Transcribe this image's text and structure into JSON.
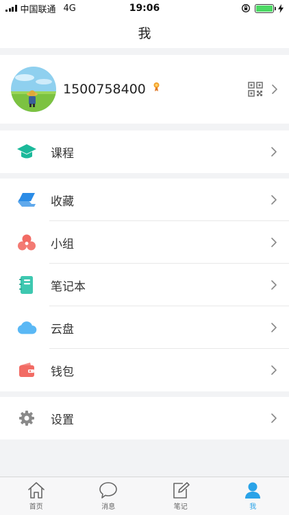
{
  "status_bar": {
    "carrier": "中国联通",
    "network": "4G",
    "time": "19:06"
  },
  "navbar": {
    "title": "我"
  },
  "profile": {
    "username": "1500758400"
  },
  "menu": {
    "course": {
      "label": "课程"
    },
    "favorites": {
      "label": "收藏"
    },
    "group": {
      "label": "小组"
    },
    "notebook": {
      "label": "笔记本"
    },
    "cloud": {
      "label": "云盘"
    },
    "wallet": {
      "label": "钱包"
    },
    "settings": {
      "label": "设置"
    }
  },
  "tabbar": {
    "home": "首页",
    "messages": "消息",
    "notes": "笔记",
    "me": "我",
    "active": "me"
  },
  "colors": {
    "accent": "#2aa3e8",
    "course": "#1bb99a",
    "favorites": "#2b8ce6",
    "group": "#f26b64",
    "notebook": "#3ec8b0",
    "cloud": "#5ab8f5",
    "wallet": "#f26b64",
    "settings": "#8a8a8a"
  },
  "icons": {
    "course": "graduation-cap-icon",
    "favorites": "stack-icon",
    "group": "circles-icon",
    "notebook": "notebook-icon",
    "cloud": "cloud-icon",
    "wallet": "wallet-icon",
    "settings": "gear-icon"
  },
  "battery_level": 1.0
}
